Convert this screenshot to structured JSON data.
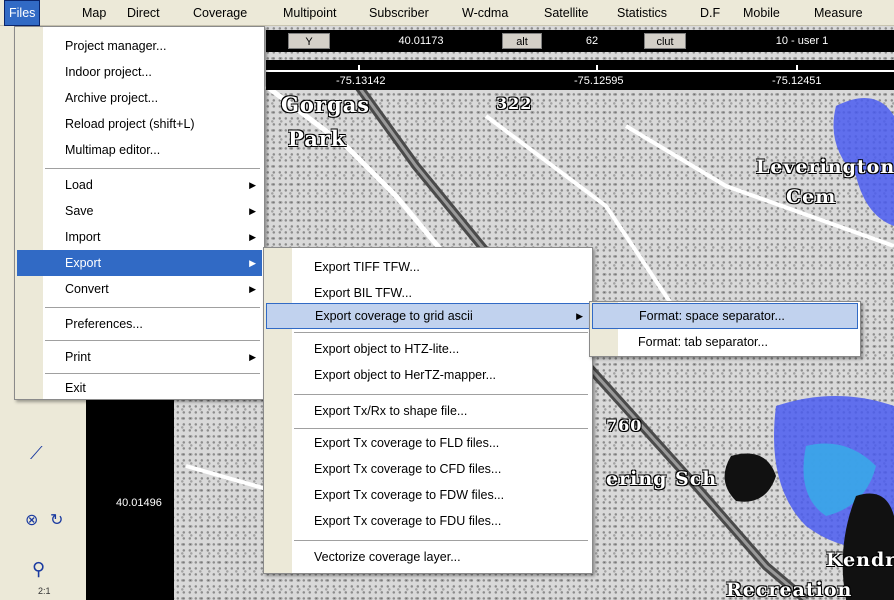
{
  "menubar": {
    "items": [
      "Files",
      "Map",
      "Direct",
      "Coverage",
      "Multipoint",
      "Subscriber",
      "W-cdma",
      "Satellite",
      "Statistics",
      "D.F",
      "Mobile",
      "Measure"
    ]
  },
  "infobar": {
    "y_label": "Y",
    "y_value": "40.01173",
    "alt_label": "alt",
    "alt_value": "62",
    "clut_label": "clut",
    "clut_value": "10 - user 1"
  },
  "ruler": {
    "coords": [
      "-75.13142",
      "-75.12595",
      "-75.12451"
    ]
  },
  "left_panel": {
    "latitude": "40.01496",
    "zoom_label": "2:1"
  },
  "map_labels": [
    "Gorgas",
    "Park",
    "Leverington",
    "Cem",
    "Kendrick",
    "Recreation Cente",
    "ering Sch",
    "322",
    "760"
  ],
  "files_menu": {
    "items": [
      {
        "label": "Project manager..."
      },
      {
        "label": "Indoor project..."
      },
      {
        "label": "Archive project..."
      },
      {
        "label": "Reload project (shift+L)"
      },
      {
        "label": "Multimap editor..."
      },
      {
        "label": "Load",
        "submenu": true
      },
      {
        "label": "Save",
        "submenu": true
      },
      {
        "label": "Import",
        "submenu": true
      },
      {
        "label": "Export",
        "submenu": true
      },
      {
        "label": "Convert",
        "submenu": true
      },
      {
        "label": "Preferences..."
      },
      {
        "label": "Print",
        "submenu": true
      },
      {
        "label": "Exit"
      }
    ]
  },
  "export_menu": {
    "items": [
      {
        "label": "Export TIFF TFW..."
      },
      {
        "label": "Export BIL TFW..."
      },
      {
        "label": "Export coverage to grid ascii",
        "submenu": true
      },
      {
        "label": "Export object to HTZ-lite..."
      },
      {
        "label": "Export object to HerTZ-mapper..."
      },
      {
        "label": "Export Tx/Rx to shape file..."
      },
      {
        "label": "Export Tx coverage to FLD files..."
      },
      {
        "label": "Export Tx coverage to CFD files..."
      },
      {
        "label": "Export Tx coverage to FDW files..."
      },
      {
        "label": "Export Tx coverage to FDU files..."
      },
      {
        "label": "Vectorize coverage layer..."
      }
    ]
  },
  "format_menu": {
    "items": [
      {
        "label": "Format: space separator..."
      },
      {
        "label": "Format: tab separator..."
      }
    ]
  },
  "colors": {
    "menu_highlight": "#316ac5",
    "menu_highlight_soft": "#c1d2ee",
    "coverage_blue": "#4a5cf0",
    "coverage_cyan": "#3aa7e8"
  }
}
